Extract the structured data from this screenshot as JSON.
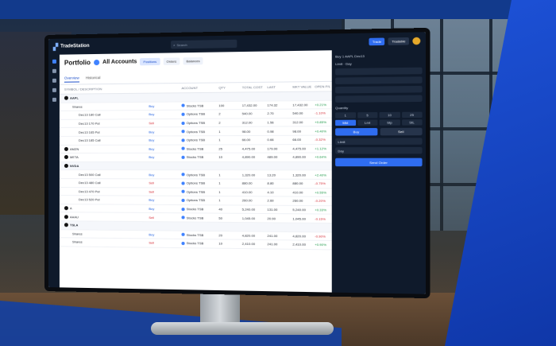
{
  "app": {
    "brand": "TradeStation",
    "search_placeholder": "Search"
  },
  "topbar": {
    "trade_label": "Trade",
    "mode_label": "Tradable"
  },
  "portfolio": {
    "title": "Portfolio",
    "account_selector": "All Accounts",
    "chips": [
      "Positions",
      "Orders",
      "Balances"
    ],
    "tabs": [
      "Overview",
      "Historical"
    ],
    "columns": [
      "SYMBOL / DESCRIPTION",
      "",
      "ACCOUNT",
      "QTY",
      "TOTAL COST",
      "LAST",
      "MKT VALUE",
      "OPEN P/L"
    ],
    "rows": [
      {
        "symbol": "AAPL",
        "desc": "Apple Inc",
        "type": "group",
        "side": "",
        "account": "",
        "qty": "",
        "cost": "",
        "last": "",
        "mv": "",
        "pl": ""
      },
      {
        "symbol": "Shares",
        "type": "leg1",
        "side": "Buy",
        "account": "Stocks TSB",
        "qty": "100",
        "cost": "17,432.00",
        "last": "174.32",
        "mv": "17,432.00",
        "pl": "+0.21%"
      },
      {
        "symbol": "Dec13 180 Call",
        "type": "leg2",
        "side": "Buy",
        "account": "Options TSB",
        "qty": "2",
        "cost": "540.00",
        "last": "2.70",
        "mv": "540.00",
        "pl": "-1.10%"
      },
      {
        "symbol": "Dec13 170 Put",
        "type": "leg2",
        "side": "Sell",
        "account": "Options TSB",
        "qty": "2",
        "cost": "312.00",
        "last": "1.56",
        "mv": "312.00",
        "pl": "+0.85%"
      },
      {
        "symbol": "Dec13 165 Put",
        "type": "leg2",
        "side": "Buy",
        "account": "Options TSB",
        "qty": "1",
        "cost": "98.00",
        "last": "0.98",
        "mv": "98.00",
        "pl": "+0.40%"
      },
      {
        "symbol": "Dec13 185 Call",
        "type": "leg2",
        "side": "Buy",
        "account": "Options TSB",
        "qty": "1",
        "cost": "66.00",
        "last": "0.66",
        "mv": "66.00",
        "pl": "-0.32%"
      },
      {
        "symbol": "AMZN",
        "desc": "Amazon.com Inc",
        "type": "group1",
        "side": "Buy",
        "account": "Stocks TSB",
        "qty": "25",
        "cost": "4,475.00",
        "last": "179.00",
        "mv": "4,475.00",
        "pl": "+1.12%"
      },
      {
        "symbol": "META",
        "desc": "Meta Platforms",
        "type": "group1",
        "side": "Buy",
        "account": "Stocks TSB",
        "qty": "10",
        "cost": "4,890.00",
        "last": "489.00",
        "mv": "4,890.00",
        "pl": "+0.64%"
      },
      {
        "symbol": "NVDA",
        "desc": "NVIDIA Corp",
        "type": "group",
        "side": "",
        "account": "",
        "qty": "",
        "cost": "",
        "last": "",
        "mv": "",
        "pl": ""
      },
      {
        "symbol": "Dec13 500 Call",
        "type": "leg2",
        "side": "Buy",
        "account": "Options TSB",
        "qty": "1",
        "cost": "1,320.00",
        "last": "13.20",
        "mv": "1,320.00",
        "pl": "+2.40%"
      },
      {
        "symbol": "Dec13 480 Call",
        "type": "leg2",
        "side": "Sell",
        "account": "Options TSB",
        "qty": "1",
        "cost": "880.00",
        "last": "8.80",
        "mv": "880.00",
        "pl": "-0.75%"
      },
      {
        "symbol": "Dec13 470 Put",
        "type": "leg2",
        "side": "Sell",
        "account": "Options TSB",
        "qty": "1",
        "cost": "410.00",
        "last": "4.10",
        "mv": "410.00",
        "pl": "+0.55%"
      },
      {
        "symbol": "Dec13 520 Put",
        "type": "leg2",
        "side": "Buy",
        "account": "Options TSB",
        "qty": "1",
        "cost": "260.00",
        "last": "2.60",
        "mv": "260.00",
        "pl": "-0.20%"
      },
      {
        "symbol": "A",
        "desc": "Agilent",
        "type": "group1",
        "side": "Buy",
        "account": "Stocks TSB",
        "qty": "40",
        "cost": "5,240.00",
        "last": "131.00",
        "mv": "5,240.00",
        "pl": "+0.33%"
      },
      {
        "symbol": "AAAU",
        "desc": "Gold ETF",
        "type": "group1",
        "side": "Sell",
        "account": "Stocks TSB",
        "qty": "50",
        "cost": "1,045.00",
        "last": "20.90",
        "mv": "1,045.00",
        "pl": "-0.15%"
      },
      {
        "symbol": "TSLA",
        "desc": "Tesla Inc",
        "type": "group",
        "side": "",
        "account": "",
        "qty": "",
        "cost": "",
        "last": "",
        "mv": "",
        "pl": ""
      },
      {
        "symbol": "Shares",
        "type": "leg1",
        "side": "Buy",
        "account": "Stocks TSB",
        "qty": "20",
        "cost": "4,820.00",
        "last": "241.00",
        "mv": "4,820.00",
        "pl": "-0.90%"
      },
      {
        "symbol": "Shares",
        "type": "leg1",
        "side": "Sell",
        "account": "Stocks TSB",
        "qty": "10",
        "cost": "2,410.00",
        "last": "241.00",
        "mv": "2,410.00",
        "pl": "+0.90%"
      }
    ]
  },
  "order_panel": {
    "symbol_line": "Buy 1 AAPL Dec13",
    "detail_line": "Limit · Day",
    "qty_label": "Quantity",
    "order_type": "Limit",
    "tif": "Day",
    "buy_label": "Buy",
    "sell_label": "Sell",
    "send_label": "Send Order",
    "grid": [
      "1",
      "5",
      "10",
      "25",
      "Mkt",
      "Lmt",
      "Stp",
      "StL"
    ]
  },
  "colors": {
    "accent": "#2f6df0",
    "brand_blue": "#1540a0",
    "positive": "#1f9a4a",
    "negative": "#d6303a"
  }
}
